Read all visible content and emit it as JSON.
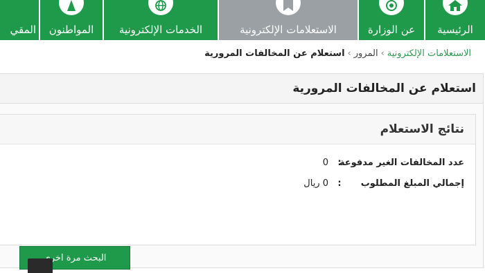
{
  "nav": {
    "items": [
      {
        "label": "الرئيسية",
        "icon": "home-icon"
      },
      {
        "label": "عن الوزارة",
        "icon": "ministry-emblem-icon"
      },
      {
        "label": "الاستعلامات الإلكترونية",
        "icon": "inquiry-icon",
        "active": true
      },
      {
        "label": "الخدمات الإلكترونية",
        "icon": "globe-icon"
      },
      {
        "label": "المواطنون",
        "icon": "citizens-icon"
      },
      {
        "label": "المقي",
        "icon": "residents-icon"
      }
    ]
  },
  "breadcrumb": {
    "root": "الاستعلامات الإلكترونية",
    "section": "المرور",
    "current": "استعلام عن المخالفات المرورية"
  },
  "page": {
    "title": "استعلام عن المخالفات المرورية"
  },
  "results": {
    "title": "نتائج الاستعلام",
    "rows": [
      {
        "label": "عدد المخالفات الغير مدفوعة",
        "colon": ":",
        "value": "0"
      },
      {
        "label": "إجمالي المبلغ المطلوب",
        "colon": ":",
        "value": "0 ريال"
      }
    ],
    "search_again_label": "البحث مرة اخرى"
  },
  "colors": {
    "primary_green": "#1e9a4a",
    "active_tab_gray": "#9aa0a4"
  }
}
